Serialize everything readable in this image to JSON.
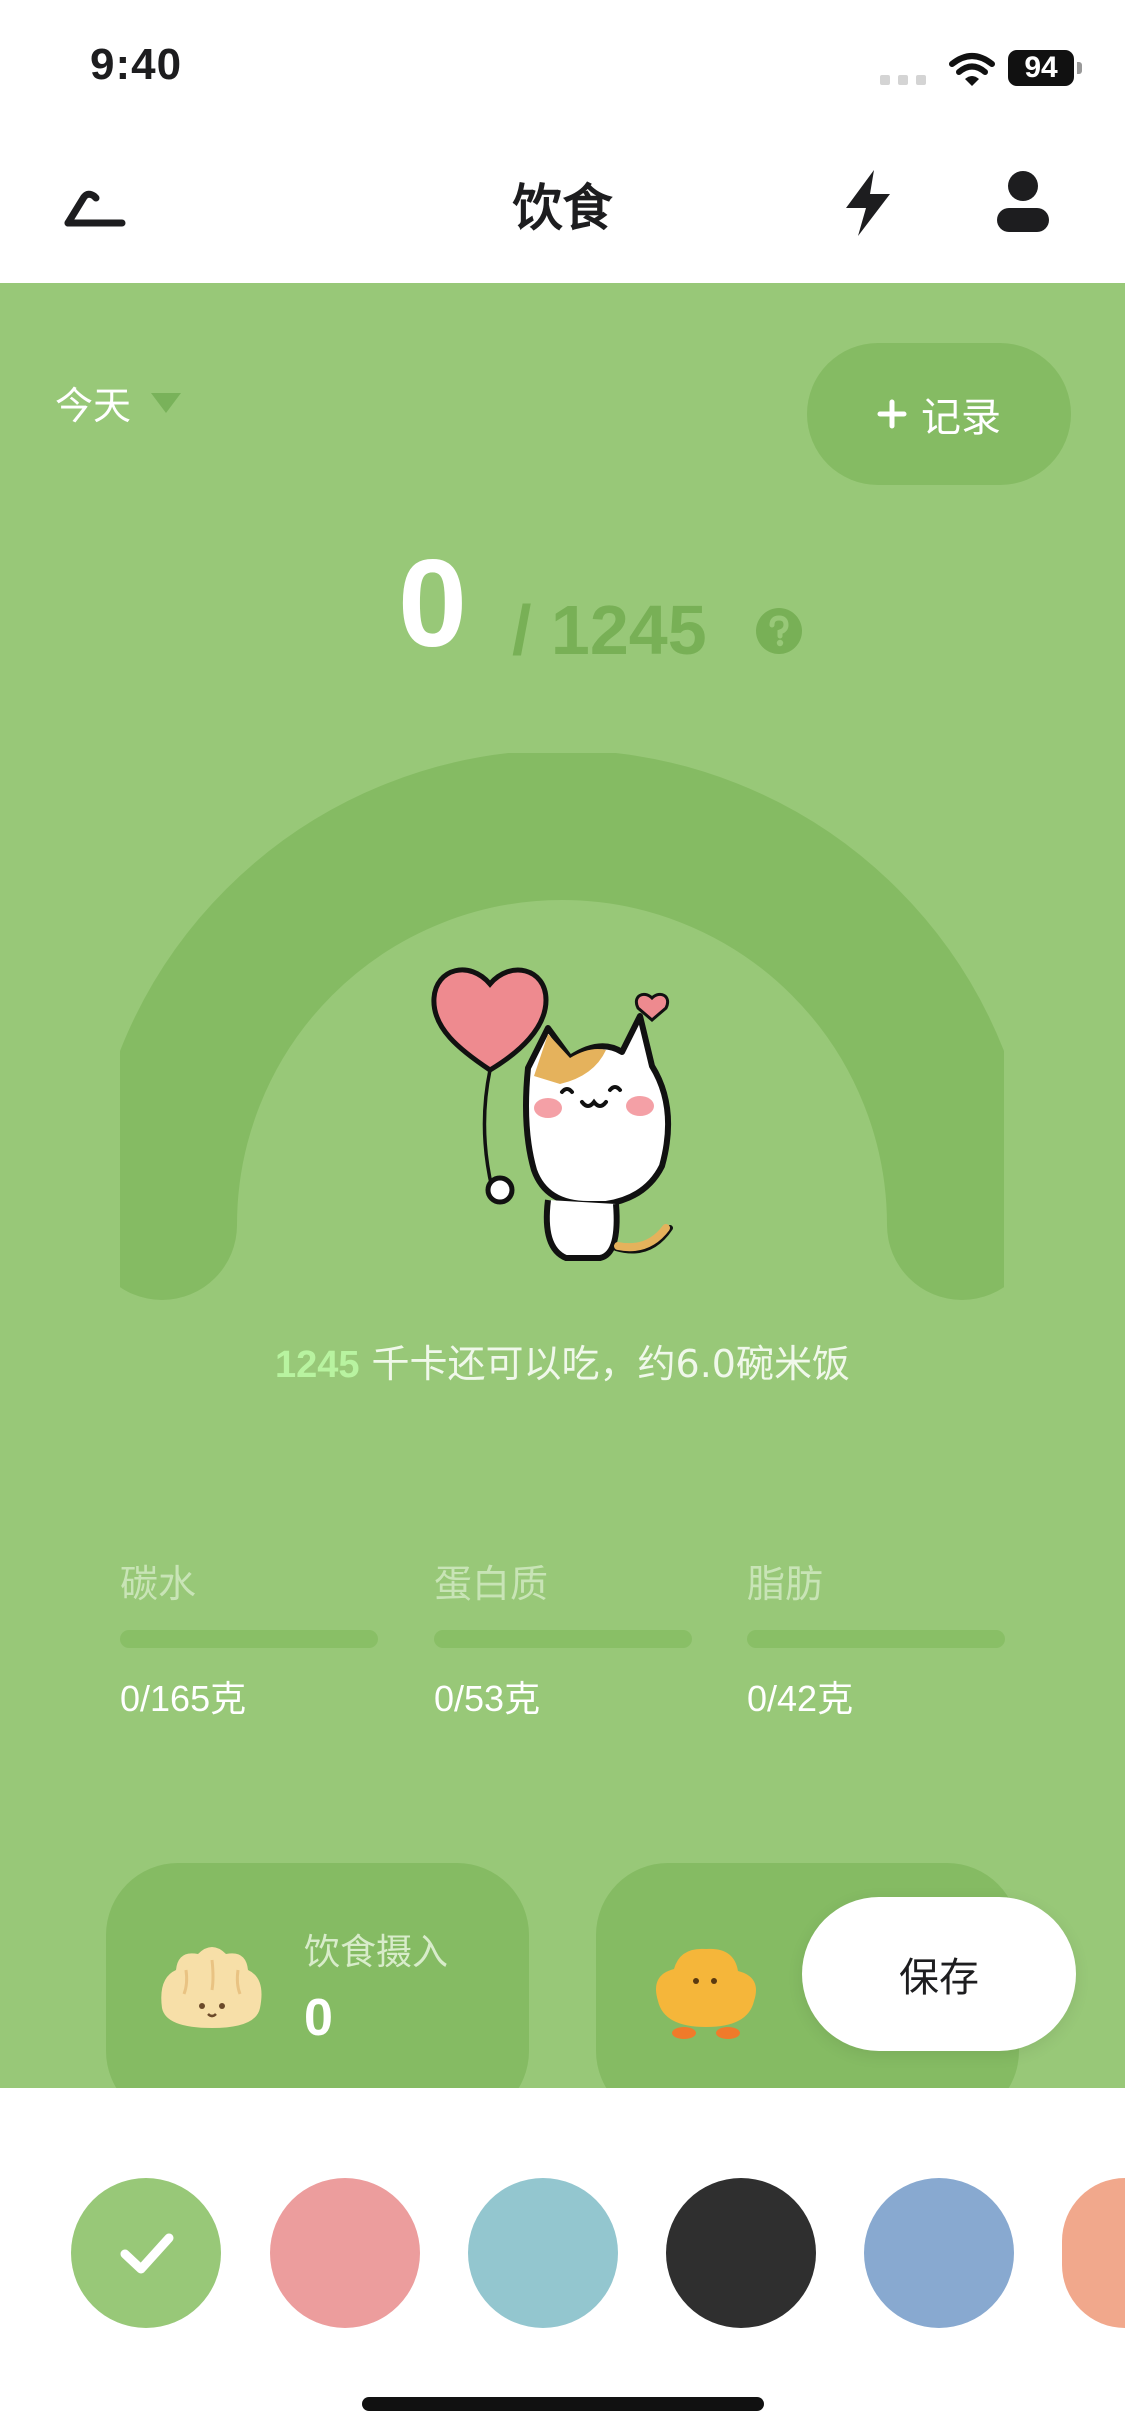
{
  "status": {
    "time": "9:40",
    "battery": "94"
  },
  "nav": {
    "title": "饮食"
  },
  "icons": {
    "back": "back-arrow-icon",
    "bolt": "lightning-bolt-icon",
    "user": "person-icon",
    "help": "question-icon",
    "check": "checkmark-icon"
  },
  "header": {
    "date": "今天",
    "record_label": "记录"
  },
  "summary": {
    "consumed": "0",
    "goal": "/ 1245"
  },
  "remaining": {
    "value": "1245",
    "text": "千卡还可以吃，约6.0碗米饭"
  },
  "macros": [
    {
      "label": "碳水",
      "value": "0/165克",
      "fraction": 0
    },
    {
      "label": "蛋白质",
      "value": "0/53克",
      "fraction": 0
    },
    {
      "label": "脂肪",
      "value": "0/42克",
      "fraction": 0
    }
  ],
  "cards": {
    "intake": {
      "label": "饮食摄入",
      "value": "0"
    }
  },
  "save_label": "保存",
  "palette": {
    "colors": [
      "#98c878",
      "#ec9d9d",
      "#93c6cf",
      "#2f2f2f",
      "#88a9d0",
      "#f1a88c"
    ],
    "selected": 0
  },
  "colors": {
    "accent": "#98c878",
    "accent_dark": "#85bb63",
    "highlight": "#b8f3a0"
  }
}
